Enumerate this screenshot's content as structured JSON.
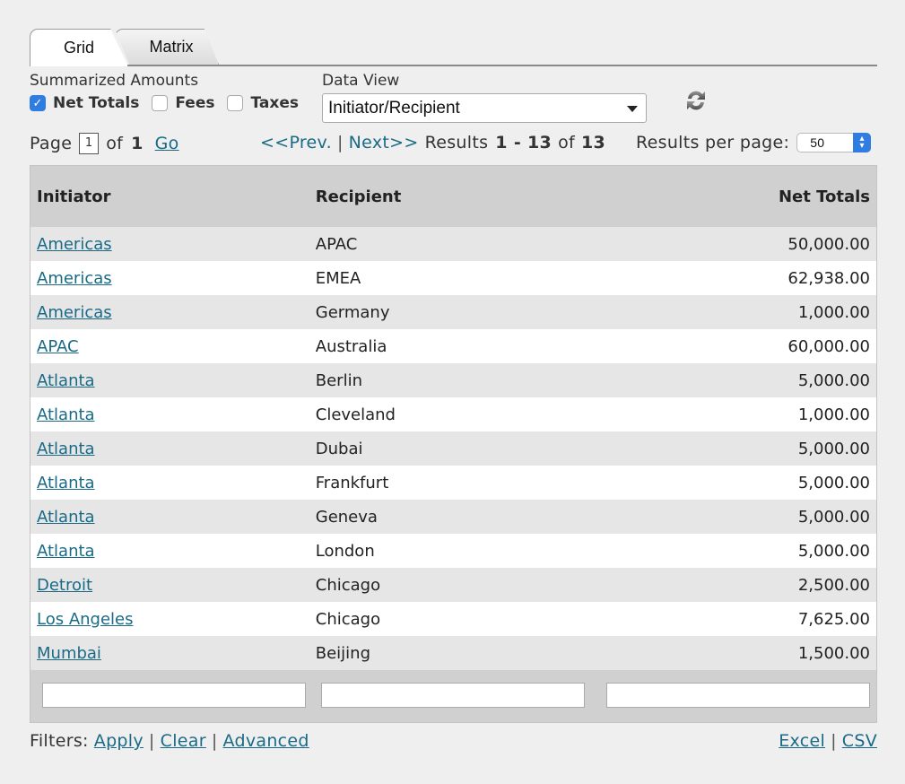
{
  "tabs": [
    {
      "label": "Grid",
      "active": true
    },
    {
      "label": "Matrix",
      "active": false
    }
  ],
  "summarized": {
    "label": "Summarized Amounts",
    "options": [
      {
        "label": "Net Totals",
        "checked": true
      },
      {
        "label": "Fees",
        "checked": false
      },
      {
        "label": "Taxes",
        "checked": false
      }
    ]
  },
  "data_view": {
    "label": "Data View",
    "selected": "Initiator/Recipient"
  },
  "icons": {
    "refresh": "refresh-icon",
    "checkmark": "✓"
  },
  "pager": {
    "page_label": "Page",
    "page_value": "1",
    "of_label": "of",
    "total_pages": "1",
    "go_label": "Go",
    "prev_label": "<<Prev.",
    "next_label": "Next>>",
    "results_label": "Results",
    "results_start": "1",
    "results_dash": "-",
    "results_end": "13",
    "results_of": "of",
    "results_total": "13",
    "per_page_label": "Results per page:",
    "per_page_value": "50"
  },
  "table": {
    "columns": [
      "Initiator",
      "Recipient",
      "Net Totals"
    ],
    "rows": [
      {
        "initiator": "Americas",
        "recipient": "APAC",
        "net": "50,000.00"
      },
      {
        "initiator": "Americas",
        "recipient": "EMEA",
        "net": "62,938.00"
      },
      {
        "initiator": "Americas",
        "recipient": "Germany",
        "net": "1,000.00"
      },
      {
        "initiator": "APAC",
        "recipient": "Australia",
        "net": "60,000.00"
      },
      {
        "initiator": "Atlanta",
        "recipient": "Berlin",
        "net": "5,000.00"
      },
      {
        "initiator": "Atlanta",
        "recipient": "Cleveland",
        "net": "1,000.00"
      },
      {
        "initiator": "Atlanta",
        "recipient": "Dubai",
        "net": "5,000.00"
      },
      {
        "initiator": "Atlanta",
        "recipient": "Frankfurt",
        "net": "5,000.00"
      },
      {
        "initiator": "Atlanta",
        "recipient": "Geneva",
        "net": "5,000.00"
      },
      {
        "initiator": "Atlanta",
        "recipient": "London",
        "net": "5,000.00"
      },
      {
        "initiator": "Detroit",
        "recipient": "Chicago",
        "net": "2,500.00"
      },
      {
        "initiator": "Los Angeles",
        "recipient": "Chicago",
        "net": "7,625.00"
      },
      {
        "initiator": "Mumbai",
        "recipient": "Beijing",
        "net": "1,500.00"
      }
    ],
    "filters": [
      "",
      "",
      ""
    ]
  },
  "footer": {
    "filters_label": "Filters:",
    "apply_label": "Apply",
    "clear_label": "Clear",
    "advanced_label": "Advanced",
    "excel_label": "Excel",
    "csv_label": "CSV",
    "separator": "|"
  },
  "colors": {
    "link": "#1a6a86",
    "checkbox_accent": "#2f7de1",
    "header_bg": "#d0d0d0",
    "row_alt_bg": "#e6e6e6",
    "page_bg": "#efefef"
  }
}
